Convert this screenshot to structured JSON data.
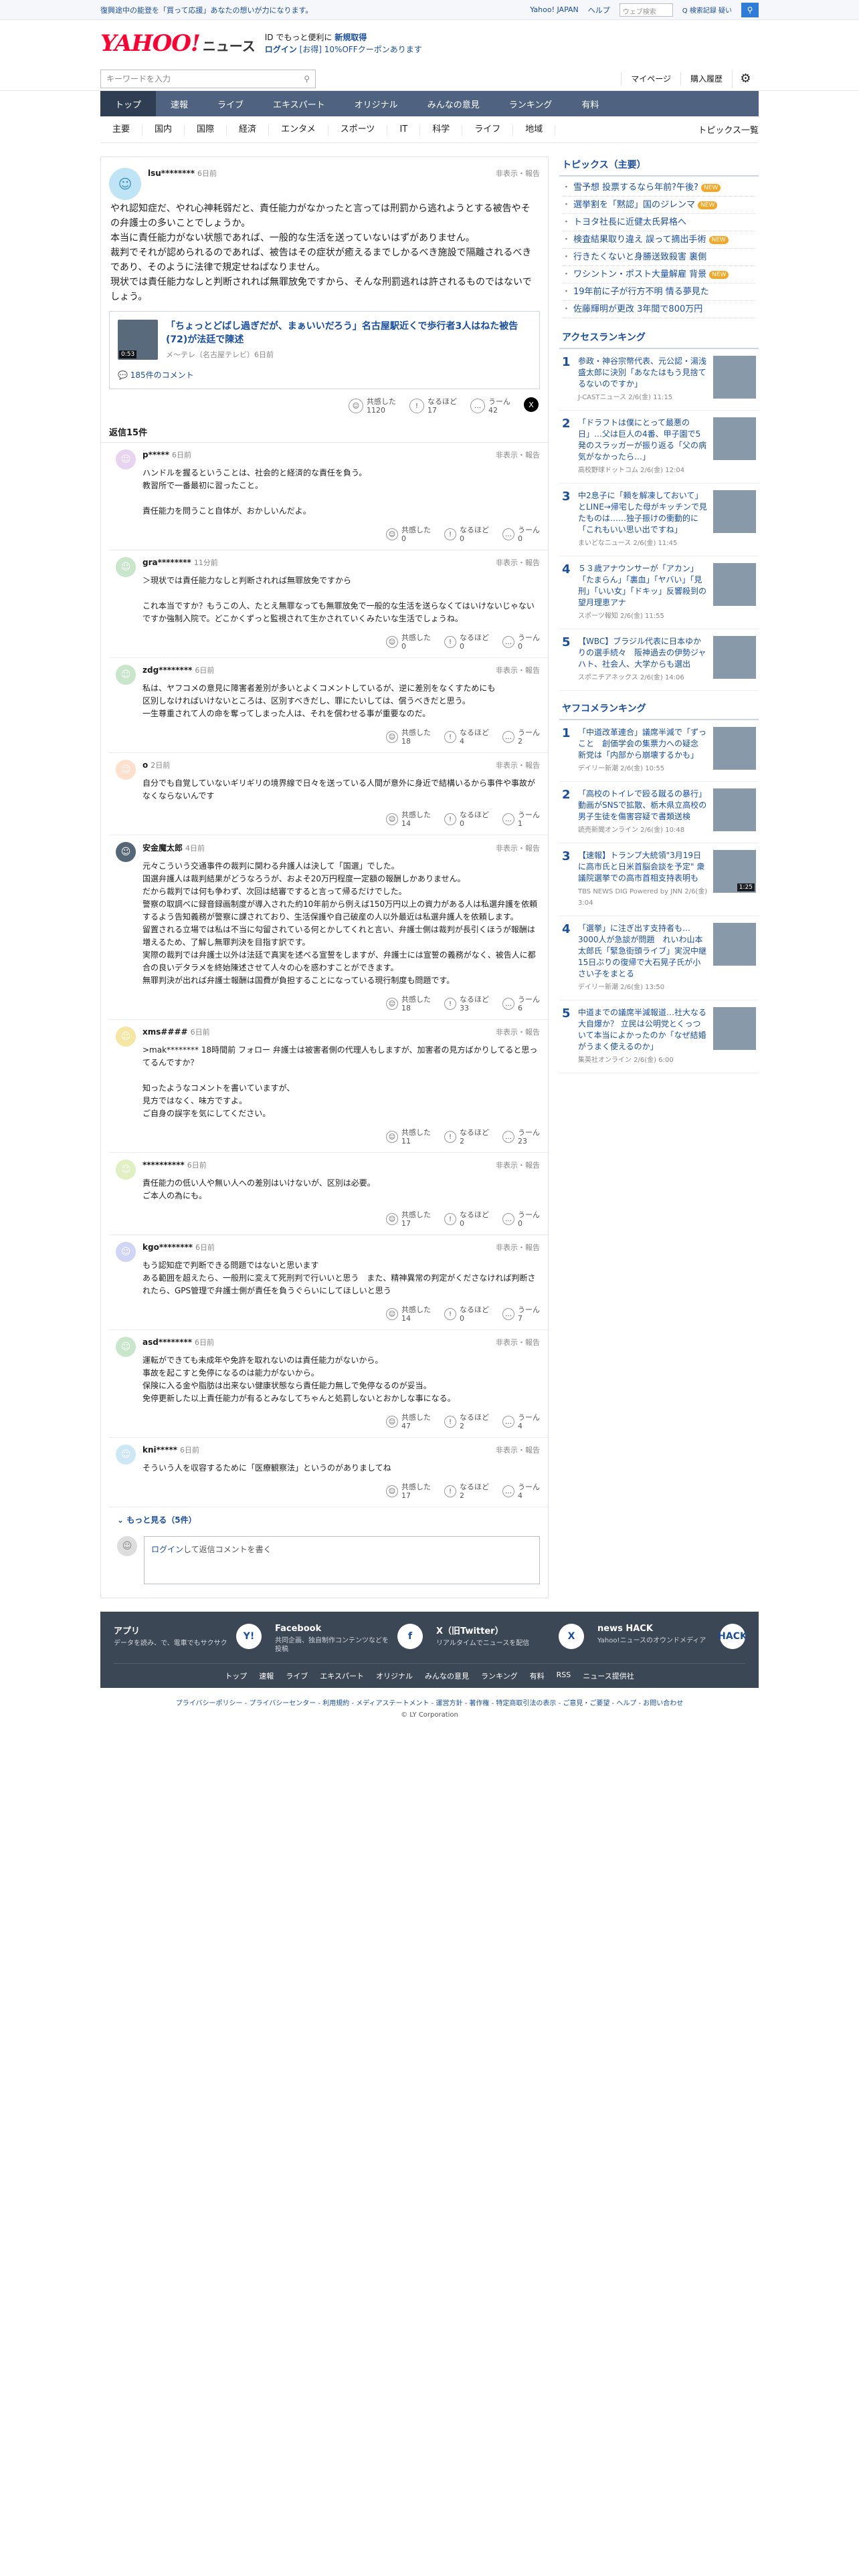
{
  "topbar": {
    "promo": "復興途中の能登を「買って応援」あなたの想いが力になります。",
    "yahoo_link": "Yahoo! JAPAN",
    "help": "ヘルプ",
    "search_placeholder": "ウェブ検索",
    "search_opt": "Q 検索記録 疑い"
  },
  "header": {
    "logo": "YAHOO!",
    "logo_sub": "JAPAN",
    "logo_news": "ニュース",
    "msg1": "ID でもっと便利に",
    "msg1b": "新規取得",
    "msg2": "ログイン",
    "msg2b": "[お得] 10%OFFクーポンあります"
  },
  "subhead": {
    "kw_placeholder": "キーワードを入力",
    "mypage": "マイページ",
    "history": "購入履歴"
  },
  "nav": [
    "トップ",
    "速報",
    "ライブ",
    "エキスパート",
    "オリジナル",
    "みんなの意見",
    "ランキング",
    "有料"
  ],
  "subnav": [
    "主要",
    "国内",
    "国際",
    "経済",
    "エンタメ",
    "スポーツ",
    "IT",
    "科学",
    "ライフ",
    "地域"
  ],
  "subnav_right": "トピックス一覧",
  "main_comment": {
    "user": "lsu********",
    "time": "6日前",
    "report": "非表示・報告",
    "text": "やれ認知症だ、やれ心神耗弱だと、責任能力がなかったと言っては刑罰から逃れようとする被告やその弁護士の多いことでしょうか。\n本当に責任能力がない状態であれば、一般的な生活を送っていないはずがありません。\n裁判でそれが認められるのであれば、被告はその症状が癒えるまでしかるべき施設で隔離されるべきであり、そのように法律で規定せねばなりません。\n現状では責任能力なしと判断されれば無罪放免ですから、そんな刑罰逃れは許されるものではないでしょう。",
    "empathy_label": "共感した",
    "empathy": "1120",
    "naruhodo_label": "なるほど",
    "naruhodo": "17",
    "uun_label": "うーん",
    "uun": "42"
  },
  "article": {
    "title": "「ちょっとどばし過ぎだが、まぁいいだろう」名古屋駅近くで歩行者3人はねた被告(72)が法廷で陳述",
    "source": "メ〜テレ（名古屋テレビ）6日前",
    "duration": "0:53",
    "comments": "185件のコメント"
  },
  "reply_header": {
    "label": "返信",
    "count": "15",
    "suffix": "件"
  },
  "replies": [
    {
      "user": "p*****",
      "time": "6日前",
      "text": "ハンドルを握るということは、社会的と経済的な責任を負う。\n教習所で一番最初に習ったこと。\n\n責任能力を問うこと自体が、おかしいんだよ。",
      "e": "0",
      "n": "0",
      "u": "0",
      "color": "#e8d4f0"
    },
    {
      "user": "gra********",
      "time": "11分前",
      "text": "＞現状では責任能力なしと判断されれば無罪放免ですから\n\nこれ本当ですか？もうこの人、たとえ無罪なっても無罪放免で一般的な生活を送らなくてはいけないじゃないですか強制入院で。どこかくずっと監視されて生かされていくみたいな生活でしょうね。",
      "e": "0",
      "n": "0",
      "u": "0",
      "color": "#c8e6c9"
    },
    {
      "user": "zdg********",
      "time": "6日前",
      "text": "私は、ヤフコメの意見に障害者差別が多いとよくコメントしているが、逆に差別をなくすためにも\n区別しなければいけないところは、区別すべきだし、罪にたいしては、償うべきだと思う。\n一生尊重されて人の命を奪ってしまった人は、それを償わせる事が重要なのだ。",
      "e": "18",
      "n": "4",
      "u": "2",
      "color": "#c8e6c9"
    },
    {
      "user": "o",
      "time": "2日前",
      "text": "自分でも自覚していないギリギリの境界線で日々を送っている人間が意外に身近で結構いるから事件や事故がなくならないんです",
      "e": "14",
      "n": "0",
      "u": "1",
      "color": "#ffe0cc"
    },
    {
      "user": "安金魔太郎",
      "time": "4日前",
      "text": "元々こういう交通事件の裁判に関わる弁護人は決して「国選」でした。\n国選弁護人は裁判結果がどうなろうが、およそ20万円程度一定額の報酬しかありません。\nだから裁判では何も争わず、次回は結審ですると言って帰るだけでした。\n警察の取調べに録音録画制度が導入された約10年前から例えば150万円以上の資力がある人は私選弁護を依頼するよう告知義務が警察に課されており、生活保護や自己破産の人以外最近は私選弁護人を依頼します。\n留置される立場では私は不当に勾留されている何とかしてくれと言い、弁護士側は裁判が長引くほうが報酬は増えるため、了解し無罪判決を目指す訳です。\n実際の裁判では弁護士以外は法廷で真実を述べる宣誓をしますが、弁護士には宣誓の義務がなく、被告人に都合の良いデタラメを終始陳述させて人々の心を惑わすことができます。\n無罪判決が出れば弁護士報酬は国費が負担することになっている現行制度も問題です。",
      "e": "18",
      "n": "33",
      "u": "6",
      "color": "#556677"
    },
    {
      "user": "xms####",
      "time": "6日前",
      "text": ">mak******** 18時間前 フォロー 弁護士は被害者側の代理人もしますが、加害者の見方ばかりしてると思ってるんですか？\n\n知ったようなコメントを書いていますが、\n見方ではなく、味方ですよ。\nご自身の誤字を気にしてください。",
      "e": "11",
      "n": "2",
      "u": "23",
      "color": "#f5e6a3"
    },
    {
      "user": "**********",
      "time": "6日前",
      "text": "責任能力の低い人や無い人への差別はいけないが、区別は必要。\nご本人の為にも。",
      "e": "17",
      "n": "0",
      "u": "0",
      "color": "#e0f0c0"
    },
    {
      "user": "kgo********",
      "time": "6日前",
      "text": "もう認知症で判断できる問題ではないと思います\nある範囲を超えたら、一般刑に変えて死刑判で行いいと思う　また、精神異常の判定がくださなければ判断されたら、GPS管理で弁護士側が責任を負うぐらいにしてほしいと思う",
      "e": "14",
      "n": "0",
      "u": "7",
      "color": "#d0d4f5"
    },
    {
      "user": "asd********",
      "time": "6日前",
      "text": "運転ができても未成年や免許を取れないのは責任能力がないから。\n事故を起こすと免停になるのは能力がないから。\n保険に入る金や脂肪は出来ない健康状態なら責任能力無しで免停なるのが妥当。\n免停更新した以上責任能力が有るとみなしてちゃんと処罰しないとおかしな事になる。",
      "e": "47",
      "n": "2",
      "u": "4",
      "color": "#c8e6c9"
    },
    {
      "user": "kni*****",
      "time": "6日前",
      "text": "そういう人を収容するために「医療観察法」というのがありましてね",
      "e": "17",
      "n": "2",
      "u": "4",
      "color": "#cde8f5"
    }
  ],
  "more": "もっと見る（5件）",
  "postbox": {
    "login": "ログイン",
    "text": "して返信コメントを書く"
  },
  "topics": {
    "title": "トピックス（主要）",
    "items": [
      {
        "t": "雪予想 投票するなら年前?午後?",
        "b": "NEW"
      },
      {
        "t": "選挙割を「黙認」国のジレンマ",
        "b": "NEW"
      },
      {
        "t": "トヨタ社長に近健太氏昇格へ",
        "b": ""
      },
      {
        "t": "検査結果取り違え 誤って摘出手術",
        "b": "NEW"
      },
      {
        "t": "行きたくないと身勝送致殺害 裏側",
        "b": ""
      },
      {
        "t": "ワシントン・ポスト大量解雇 背景",
        "b": "NEW"
      },
      {
        "t": "19年前に子が行方不明 情る夢見た",
        "b": ""
      },
      {
        "t": "佐藤輝明が更改 3年間で800万円",
        "b": ""
      }
    ]
  },
  "access": {
    "title": "アクセスランキング",
    "items": [
      {
        "n": "1",
        "t": "参政・神谷宗幣代表、元公認・湯浅盛太郎に決別「あなたはもう見捨てるないのですか」",
        "s": "J-CASTニュース 2/6(金) 11:15",
        "d": ""
      },
      {
        "n": "2",
        "t": "「ドラフトは僕にとって最悪の日」…父は巨人の4番、甲子園で5発のスラッガーが振り返る「父の病気がなかったら…」",
        "s": "高校野球ドットコム 2/6(金) 12:04",
        "d": ""
      },
      {
        "n": "3",
        "t": "中2息子に「頼を解凍しておいて」とLINE→帰宅した母がキッチンで見たものは……独子振けの衝動的に「これもいい思い出ですね」",
        "s": "まいどなニュース 2/6(金) 11:45",
        "d": ""
      },
      {
        "n": "4",
        "t": "５３歳アナウンサーが「アカン」「たまらん」「裏血」「ヤバい」「見刑」「いい女」「ドキッ」反響殺到の望月理恵アナ",
        "s": "スポーツ報知 2/6(金) 11:55",
        "d": ""
      },
      {
        "n": "5",
        "t": "【WBC】ブラジル代表に日本ゆかりの選手続々　阪神過去の伊勢ジャハト、社会人、大学からも選出",
        "s": "スポニチアネックス 2/6(金) 14:06",
        "d": ""
      }
    ]
  },
  "yahoo_rank": {
    "title": "ヤフコメランキング",
    "items": [
      {
        "n": "1",
        "t": "「中道改革連合」議席半減で「ずっこと　創価学会の集票力への疑念　新党は「内部から崩壊するかも」",
        "s": "デイリー新潮 2/6(金) 10:55",
        "d": ""
      },
      {
        "n": "2",
        "t": "「高校のトイレで殴る蹴るの暴行」動画がSNSで拡散、栃木県立高校の男子生徒を傷害容疑で書類送検",
        "s": "読売新聞オンライン 2/6(金) 10:48",
        "d": ""
      },
      {
        "n": "3",
        "t": "【速報】トランプ大統領\"3月19日に高市氏と日米首脳会談を予定\" 衆議院選挙での高市首相支持表明も",
        "s": "TBS NEWS DIG Powered by JNN 2/6(金) 3:04",
        "d": "1:25"
      },
      {
        "n": "4",
        "t": "「選挙」に注ぎ出す支持者も…3000人が急談が問題　れいわ山本太郎氏「緊急街頭ライブ」実況中継　15日ぶりの復帰で大石晃子氏が小さい子をまとる",
        "s": "デイリー新潮 2/6(金) 13:50",
        "d": ""
      },
      {
        "n": "5",
        "t": "中道までの議席半減報道…社大なる大自爆か？ 立民は公明党とくっついて本当によかったのか「なぜ結婚がうまく使えるのか」",
        "s": "集英社オンライン 2/6(金) 6:00",
        "d": ""
      }
    ]
  },
  "footer": {
    "apps": [
      {
        "name": "アプリ",
        "desc": "データを読み、で、電車でもサクサク",
        "icon": "Y!"
      },
      {
        "name": "Facebook",
        "desc": "共同企画、独自制作コンテンツなどを投稿",
        "icon": "f"
      },
      {
        "name": "X（旧Twitter）",
        "desc": "リアルタイムでニュースを配信",
        "icon": "X"
      },
      {
        "name": "news HACK",
        "desc": "Yahoo!ニュースのオウンドメディア",
        "icon": "HACK"
      }
    ],
    "links": [
      "トップ",
      "速報",
      "ライブ",
      "エキスパート",
      "オリジナル",
      "みんなの意見",
      "ランキング",
      "有料",
      "RSS",
      "ニュース提供社"
    ],
    "legal": "プライバシーポリシー - プライバシーセンター - 利用規約 - メディアステートメント - 運営方針 - 著作権 - 特定商取引法の表示 - ご意見・ご要望 - ヘルプ - お問い合わせ",
    "copyright": "© LY Corporation"
  }
}
